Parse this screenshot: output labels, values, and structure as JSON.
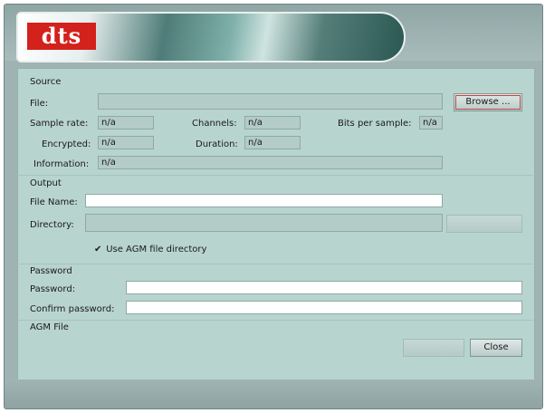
{
  "logo": "dts",
  "source": {
    "title": "Source",
    "file_label": "File:",
    "file_value": "",
    "browse_label": "Browse ...",
    "sample_rate_label": "Sample rate:",
    "sample_rate_value": "n/a",
    "channels_label": "Channels:",
    "channels_value": "n/a",
    "bits_label": "Bits per sample:",
    "bits_value": "n/a",
    "encrypted_label": "Encrypted:",
    "encrypted_value": "n/a",
    "duration_label": "Duration:",
    "duration_value": "n/a",
    "information_label": "Information:",
    "information_value": "n/a"
  },
  "output": {
    "title": "Output",
    "file_name_label": "File Name:",
    "file_name_value": "",
    "directory_label": "Directory:",
    "directory_value": "",
    "use_agm_label": "Use AGM file directory",
    "use_agm_checked": true
  },
  "password": {
    "title": "Password",
    "password_label": "Password:",
    "confirm_label": "Confirm password:"
  },
  "agm": {
    "title": "AGM File"
  },
  "footer": {
    "close_label": "Close"
  },
  "colors": {
    "window": "#9fb3b2",
    "panel": "#b8d4cf",
    "logo_red": "#d3211c"
  }
}
